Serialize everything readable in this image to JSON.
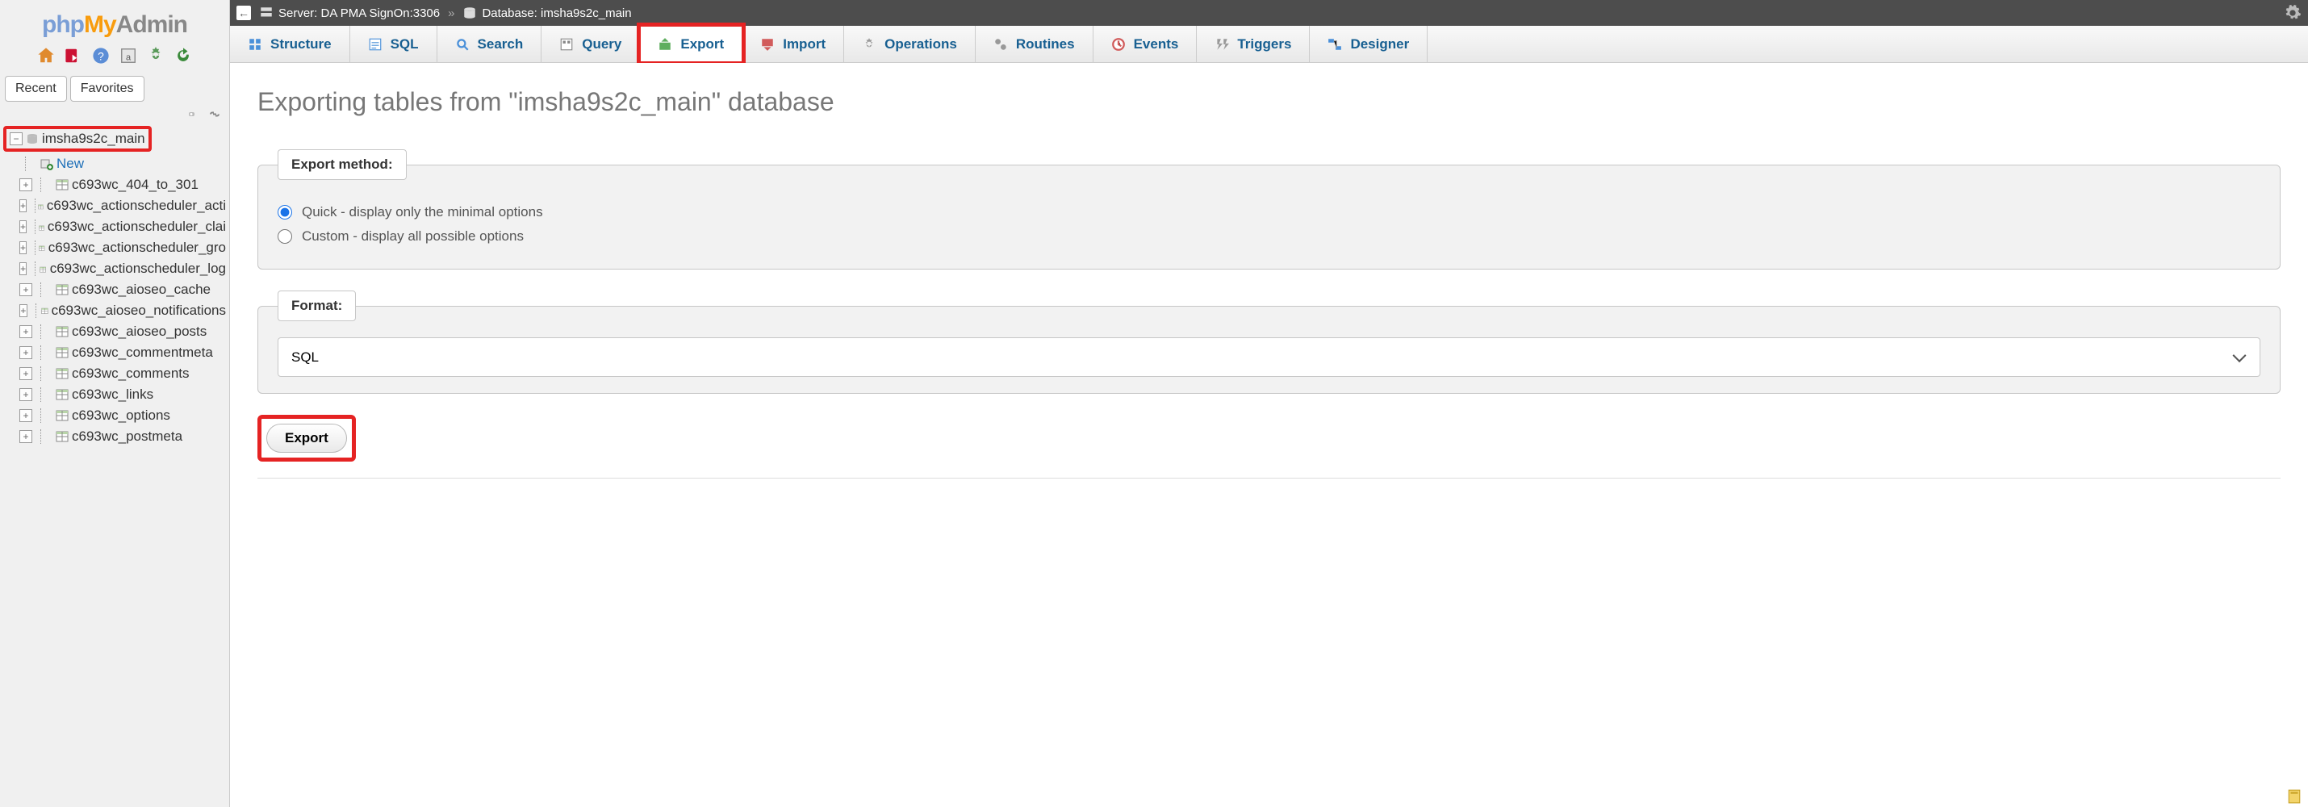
{
  "logo": {
    "php": "php",
    "my": "My",
    "admin": "Admin"
  },
  "recent": {
    "recent": "Recent",
    "favorites": "Favorites"
  },
  "breadcrumb": {
    "server_prefix": "Server:",
    "server": "DA PMA SignOn:3306",
    "db_prefix": "Database:",
    "db": "imsha9s2c_main"
  },
  "tabs": [
    {
      "id": "structure",
      "label": "Structure",
      "icon": "structure"
    },
    {
      "id": "sql",
      "label": "SQL",
      "icon": "sql"
    },
    {
      "id": "search",
      "label": "Search",
      "icon": "search"
    },
    {
      "id": "query",
      "label": "Query",
      "icon": "query"
    },
    {
      "id": "export",
      "label": "Export",
      "icon": "export"
    },
    {
      "id": "import",
      "label": "Import",
      "icon": "import"
    },
    {
      "id": "operations",
      "label": "Operations",
      "icon": "operations"
    },
    {
      "id": "routines",
      "label": "Routines",
      "icon": "routines"
    },
    {
      "id": "events",
      "label": "Events",
      "icon": "events"
    },
    {
      "id": "triggers",
      "label": "Triggers",
      "icon": "triggers"
    },
    {
      "id": "designer",
      "label": "Designer",
      "icon": "designer"
    }
  ],
  "sidebar": {
    "db": "imsha9s2c_main",
    "new": "New",
    "tables": [
      "c693wc_404_to_301",
      "c693wc_actionscheduler_acti",
      "c693wc_actionscheduler_clai",
      "c693wc_actionscheduler_gro",
      "c693wc_actionscheduler_log",
      "c693wc_aioseo_cache",
      "c693wc_aioseo_notifications",
      "c693wc_aioseo_posts",
      "c693wc_commentmeta",
      "c693wc_comments",
      "c693wc_links",
      "c693wc_options",
      "c693wc_postmeta"
    ]
  },
  "page": {
    "heading": "Exporting tables from \"imsha9s2c_main\" database",
    "export_method_legend": "Export method:",
    "quick": "Quick - display only the minimal options",
    "custom": "Custom - display all possible options",
    "format_legend": "Format:",
    "format_value": "SQL",
    "export_btn": "Export"
  }
}
